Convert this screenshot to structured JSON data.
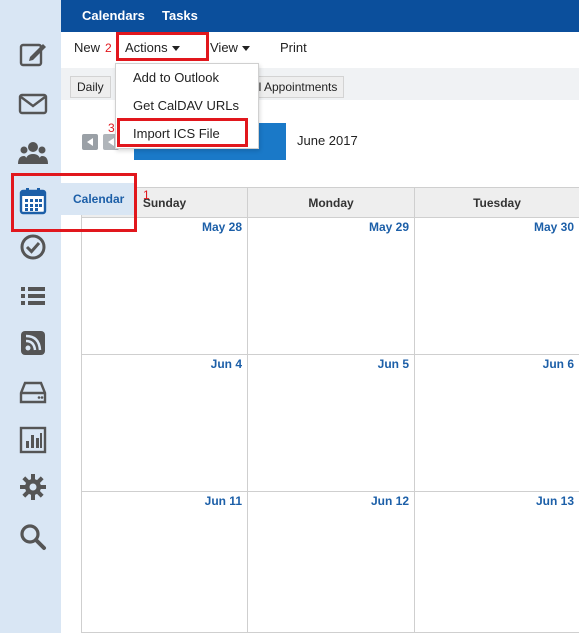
{
  "topbar": {
    "calendars": "Calendars",
    "tasks": "Tasks"
  },
  "toolbar": {
    "new": "New",
    "actions": "Actions",
    "view": "View",
    "print": "Print"
  },
  "view_tabs": [
    "Daily",
    "ll Appointments"
  ],
  "dropdown": {
    "items": [
      "Add to Outlook",
      "Get CalDAV URLs",
      "Import ICS File"
    ]
  },
  "nav": {
    "period": "June 2017"
  },
  "sidebar": {
    "active_label": "Calendar",
    "icons": [
      "edit-icon",
      "mail-icon",
      "contacts-icon",
      "calendar-icon",
      "tasks-icon",
      "list-icon",
      "rss-icon",
      "drive-icon",
      "reports-icon",
      "settings-icon",
      "search-icon"
    ]
  },
  "calendar": {
    "days": [
      "Sunday",
      "Monday",
      "Tuesday"
    ],
    "weeks": [
      [
        "May 28",
        "May 29",
        "May 30"
      ],
      [
        "Jun 4",
        "Jun 5",
        "Jun 6"
      ],
      [
        "Jun 11",
        "Jun 12",
        "Jun 13"
      ]
    ]
  },
  "annotations": [
    "1",
    "2",
    "3"
  ],
  "colors": {
    "accent": "#0b4f9c",
    "highlight": "#e1171d",
    "date": "#1c5fa8",
    "sidebar": "#d9e6f4"
  }
}
